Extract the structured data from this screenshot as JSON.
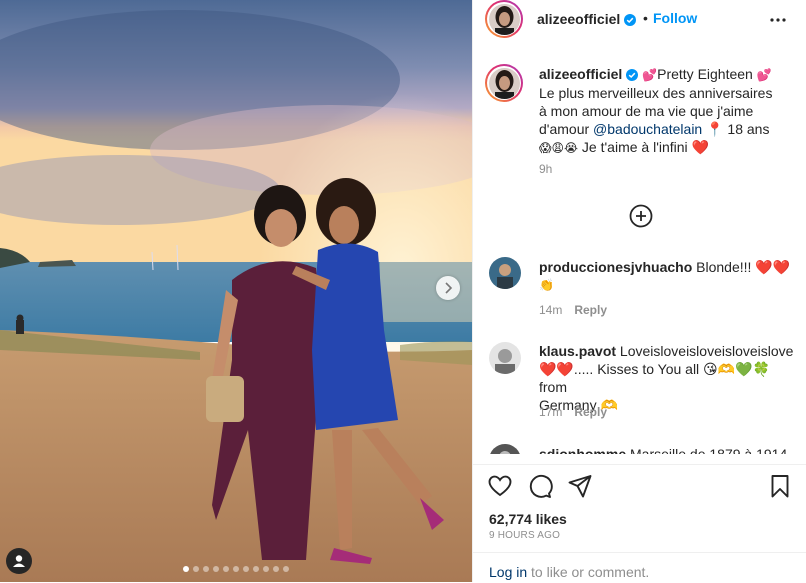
{
  "post": {
    "username": "alizeeofficiel",
    "verified": true,
    "bullet": "•",
    "follow_label": "Follow",
    "more_icon": "more-dots-icon",
    "carousel": {
      "slide_count": 11,
      "active_index": 0
    }
  },
  "caption": {
    "username": "alizeeofficiel",
    "line1_pre": "💕",
    "line1_text": "Pretty Eighteen",
    "line1_post": "💕",
    "line2": "Le plus merveilleux des anniversaires",
    "line3": "à mon amour de ma vie que j'aime",
    "line4_pre": "d'amour ",
    "mention": "@badouchatelain",
    "line4_post": " 📍 18 ans",
    "line5_emoji": "😱😩😭",
    "line5_text": " Je t'aime à l'infini ❤️",
    "time": "9h"
  },
  "comments": [
    {
      "username": "produccionesjvhuacho",
      "text": "Blonde!!! ❤️❤️",
      "text2": "👏",
      "time": "14m",
      "reply_label": "Reply"
    },
    {
      "username": "klaus.pavot",
      "text": "Loveisloveisloveisloveislove",
      "text2": "❤️❤️..... Kisses to You all 😘🫶💚🍀 from",
      "text3": "Germany 🫶",
      "time": "17m",
      "reply_label": "Reply"
    },
    {
      "username": "sdjonhomme",
      "text": "Marseille de 1879 à 1914"
    }
  ],
  "stats": {
    "likes": "62,774 likes",
    "ago": "9 HOURS AGO"
  },
  "login": {
    "link": "Log in",
    "rest": " to like or comment."
  },
  "colors": {
    "link": "#0095f6",
    "mention": "#00376b",
    "muted": "#8e8e8e",
    "heart": "#ed4956"
  }
}
